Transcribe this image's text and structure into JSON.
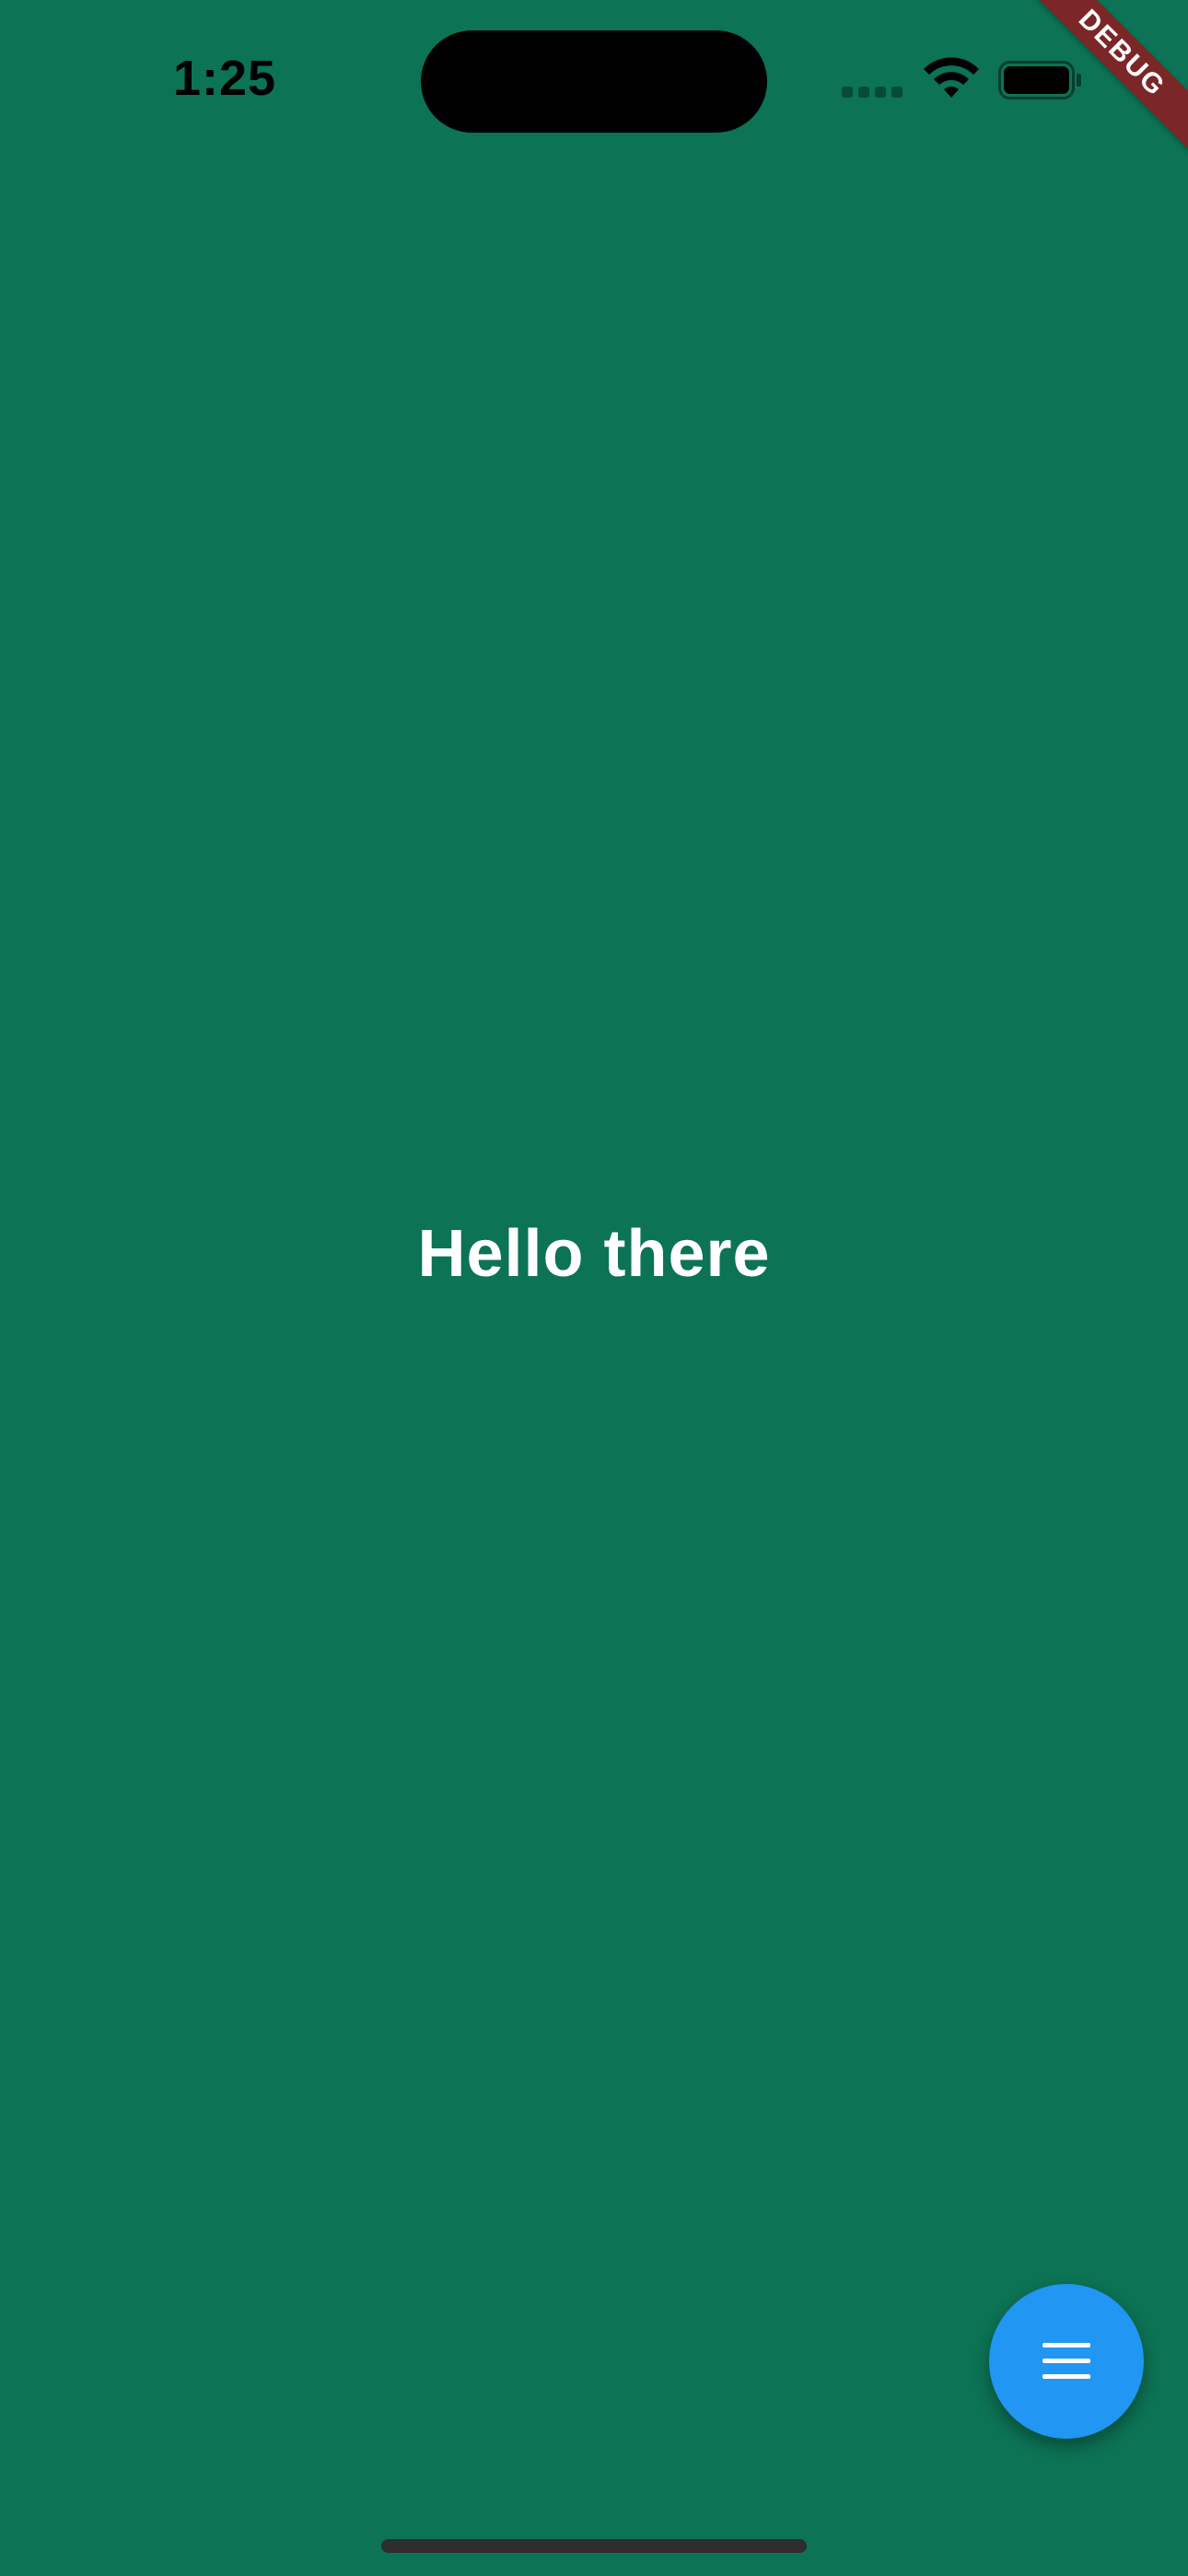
{
  "status_bar": {
    "time": "1:25",
    "signal_icon": "signal-bars-icon",
    "wifi_icon": "wifi-icon",
    "battery_icon": "battery-icon",
    "battery_level": 1.0
  },
  "debug_banner": {
    "label": "DEBUG",
    "color": "#7b2727"
  },
  "main": {
    "greeting": "Hello there",
    "background_color": "#0c7355"
  },
  "fab": {
    "icon": "menu-icon",
    "color": "#2196f3"
  }
}
